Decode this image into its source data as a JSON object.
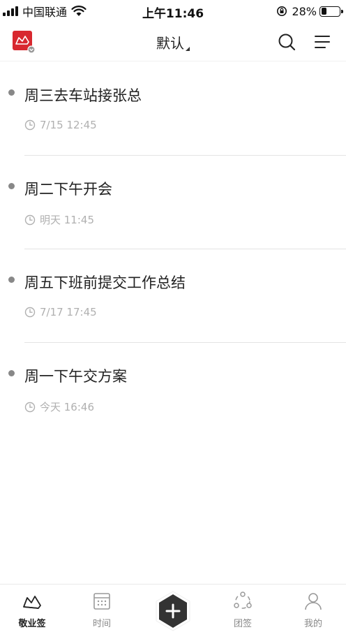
{
  "status_bar": {
    "carrier": "中国联通",
    "time": "上午11:46",
    "battery": "28%",
    "battery_level": 0.28
  },
  "header": {
    "title": "默认"
  },
  "tasks": [
    {
      "title": "周三去车站接张总",
      "time": "7/15 12:45"
    },
    {
      "title": "周二下午开会",
      "time": "明天 11:45"
    },
    {
      "title": "周五下班前提交工作总结",
      "time": "7/17 17:45"
    },
    {
      "title": "周一下午交方案",
      "time": "今天 16:46"
    }
  ],
  "tabs": [
    {
      "label": "敬业签",
      "icon": "jingyeqian-icon",
      "active": true
    },
    {
      "label": "时间",
      "icon": "calendar-icon",
      "active": false
    },
    {
      "label": "团签",
      "icon": "team-icon",
      "active": false
    },
    {
      "label": "我的",
      "icon": "user-icon",
      "active": false
    }
  ],
  "colors": {
    "accent_red": "#d8282f",
    "fab": "#333333",
    "muted_text": "#b0b0b0"
  }
}
